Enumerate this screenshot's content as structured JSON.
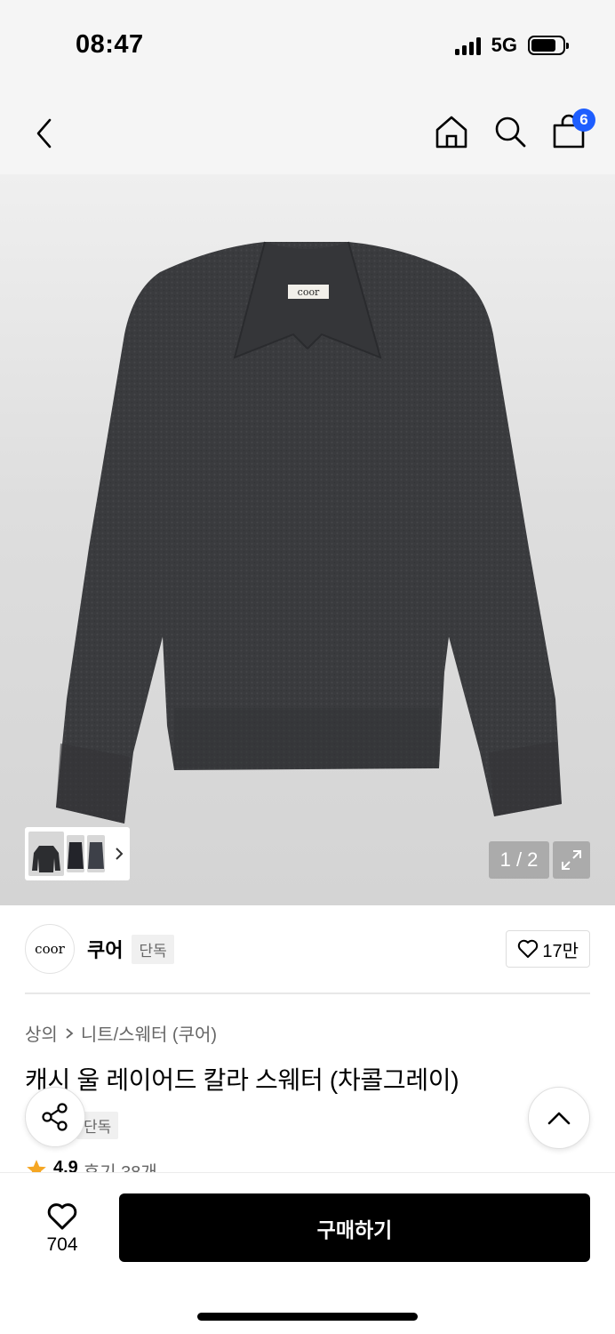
{
  "status_bar": {
    "time": "08:47",
    "network": "5G",
    "signal_bars": 4,
    "battery_level": 0.78,
    "icons": [
      "signal-icon",
      "battery-icon"
    ]
  },
  "header": {
    "icons": [
      "back-chevron-icon",
      "home-icon",
      "search-icon",
      "cart-icon"
    ],
    "cart_count": "6",
    "accent_color": "#1e5eff"
  },
  "gallery": {
    "image_label": "coor",
    "pager": "1 / 2",
    "icons": [
      "thumbnail-next-chevron-icon",
      "expand-icon"
    ]
  },
  "brand": {
    "logo_text": "coor",
    "name": "쿠어",
    "badge": "단독",
    "like_count": "17만",
    "icons": [
      "heart-icon"
    ]
  },
  "breadcrumb": {
    "category": "상의",
    "subcategory": "니트/스웨터 (쿠어)",
    "icons": [
      "chevron-right-icon"
    ]
  },
  "product": {
    "title": "캐시 울 레이어드 칼라 스웨터 (차콜그레이)",
    "badge": "단독",
    "rating": "4.9",
    "reviews": "후기 38개",
    "icons": [
      "star-icon",
      "share-icon",
      "scroll-top-icon"
    ]
  },
  "bottom_bar": {
    "wish_count": "704",
    "buy_label": "구매하기",
    "icons": [
      "heart-outline-icon"
    ]
  }
}
